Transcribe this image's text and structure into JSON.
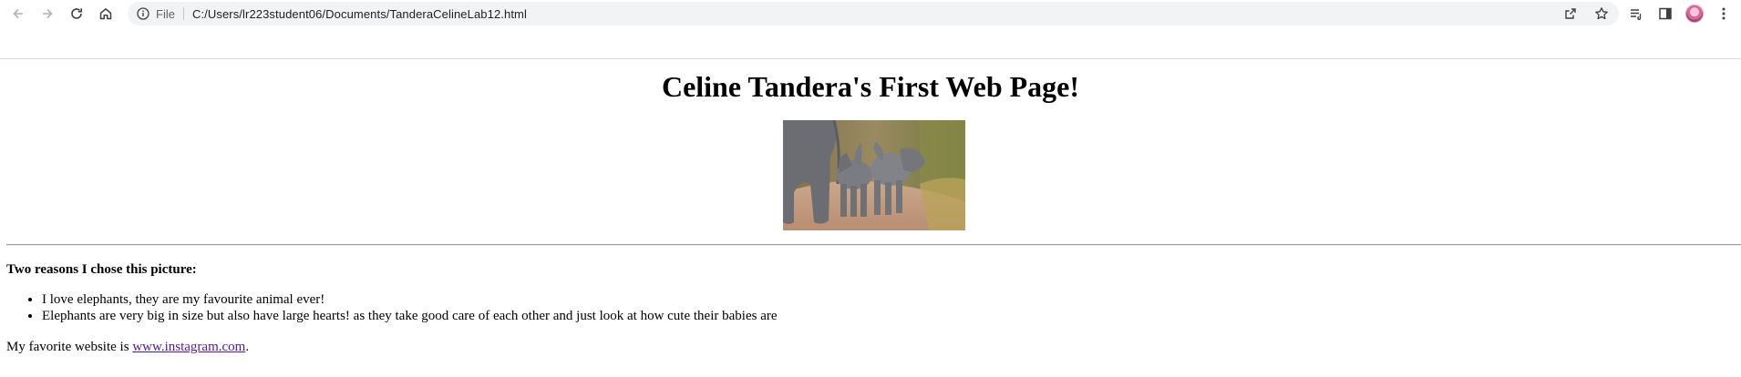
{
  "browser": {
    "scheme_label": "File",
    "url": "C:/Users/lr223student06/Documents/TanderaCelineLab12.html",
    "icons": [
      "back-arrow-icon",
      "forward-arrow-icon",
      "reload-icon",
      "home-icon",
      "info-icon",
      "share-icon",
      "bookmark-star-icon",
      "reading-list-icon",
      "side-panel-icon",
      "profile-avatar-icon",
      "menu-kebab-icon"
    ]
  },
  "page": {
    "heading": "Celine Tandera's First Web Page!",
    "reasons_heading": "Two reasons I chose this picture:",
    "reasons": [
      "I love elephants, they are my favourite animal ever!",
      "Elephants are very big in size but also have large hearts! as they take good care of each other and just look at how cute their babies are"
    ],
    "favorite_prefix": "My favorite website is ",
    "favorite_link": "www.instagram.com",
    "favorite_suffix": "."
  },
  "colors": {
    "link_visited": "#551a8b",
    "omnibox_bg": "#f1f3f4"
  }
}
